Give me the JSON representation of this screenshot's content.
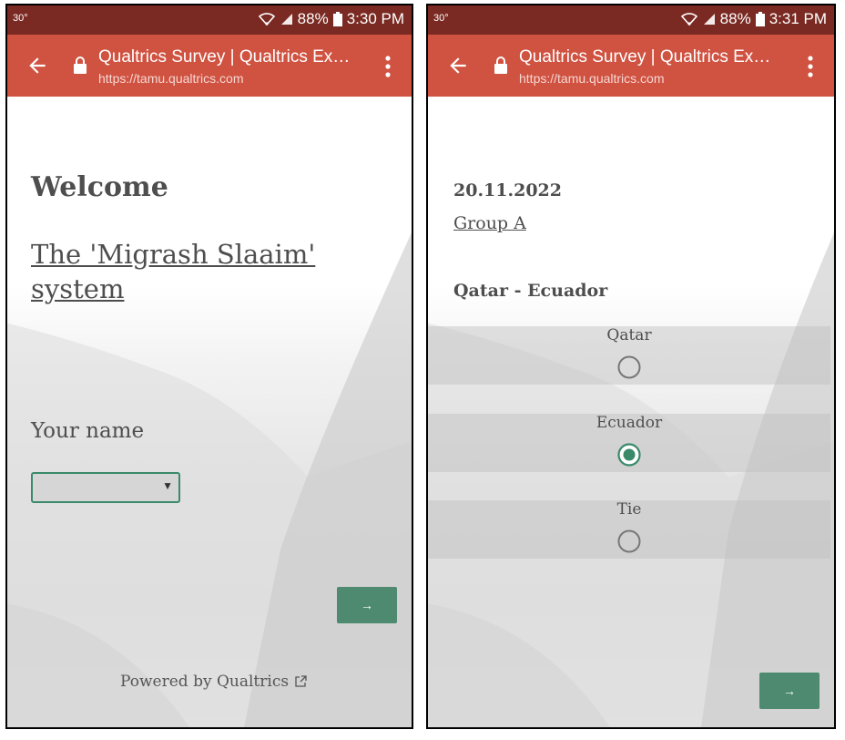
{
  "status_left": {
    "temp": "30°",
    "battery": "88%",
    "time": "3:30 PM"
  },
  "status_right": {
    "temp": "30°",
    "battery": "88%",
    "time": "3:31 PM"
  },
  "browser": {
    "title": "Qualtrics Survey | Qualtrics Ex…",
    "url": "https://tamu.qualtrics.com"
  },
  "left_page": {
    "welcome": "Welcome",
    "system_link": "The 'Migrash Slaaim' system",
    "name_label": "Your name",
    "select_value": "",
    "next_label": "→",
    "powered_by": "Powered by Qualtrics"
  },
  "right_page": {
    "date": "20.11.2022",
    "group": "Group A",
    "match": "Qatar - Ecuador",
    "options": [
      {
        "label": "Qatar",
        "selected": false
      },
      {
        "label": "Ecuador",
        "selected": true
      },
      {
        "label": "Tie",
        "selected": false
      }
    ],
    "next_label": "→"
  },
  "colors": {
    "toolbar": "#d05241",
    "statusbar": "#7a2a22",
    "accent_green": "#4d8a70"
  }
}
